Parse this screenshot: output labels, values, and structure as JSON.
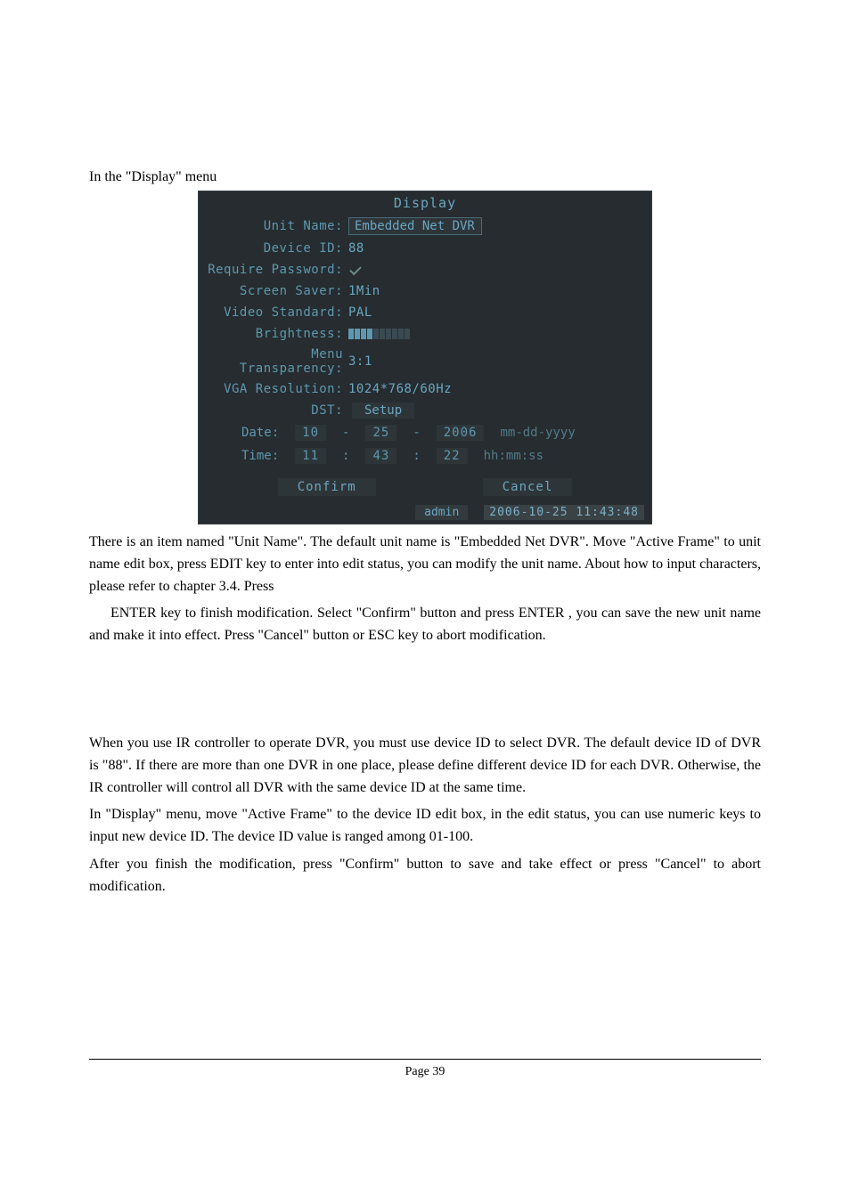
{
  "intro": "In the \"Display\" menu",
  "panel": {
    "title": "Display",
    "rows": {
      "unit_name_label": "Unit Name:",
      "unit_name_value": "Embedded Net DVR",
      "device_id_label": "Device ID:",
      "device_id_value": "88",
      "require_pw_label": "Require Password:",
      "screen_saver_label": "Screen Saver:",
      "screen_saver_value": "1Min",
      "video_std_label": "Video Standard:",
      "video_std_value": "PAL",
      "brightness_label": "Brightness:",
      "menu_trans_label": "Menu Transparency:",
      "menu_trans_value": "3:1",
      "vga_res_label": "VGA Resolution:",
      "vga_res_value": "1024*768/60Hz",
      "dst_label": "DST:",
      "dst_setup": "Setup"
    },
    "date": {
      "label": "Date:",
      "d1": "10",
      "d2": "25",
      "d3": "2006",
      "pattern": "mm-dd-yyyy",
      "sep": "-"
    },
    "time": {
      "label": "Time:",
      "t1": "11",
      "t2": "43",
      "t3": "22",
      "pattern": "hh:mm:ss",
      "sep": ":"
    },
    "buttons": {
      "confirm": "Confirm",
      "cancel": "Cancel"
    },
    "status": {
      "user": "admin",
      "timestamp": "2006-10-25 11:43:48"
    }
  },
  "para1a": "There is an item named \"Unit Name\". The default unit name is \"Embedded Net DVR\". Move \"Active Frame\" to unit name edit box, press EDIT key to enter into edit status, you can modify the unit name. About how to input characters, please refer to chapter 3.4. Press",
  "para1b": "ENTER key to finish modification. Select \"Confirm\" button and press ENTER , you can save the new unit name and make it into effect. Press \"Cancel\" button or ESC key to abort modification.",
  "para2": "When you use IR controller to operate DVR, you must use device ID to select DVR. The default device ID of DVR is \"88\". If there are more than one DVR in one place, please define different device ID for each DVR. Otherwise, the IR controller will control all DVR with the same device ID at the same time.",
  "para3": "In \"Display\" menu, move \"Active Frame\" to the device ID edit box, in the edit status, you can use numeric keys to input new device ID. The device ID value is ranged among 01-100.",
  "para4": "After you finish the modification, press \"Confirm\" button to save and take effect or press \"Cancel\" to abort modification.",
  "page_number": "Page 39"
}
